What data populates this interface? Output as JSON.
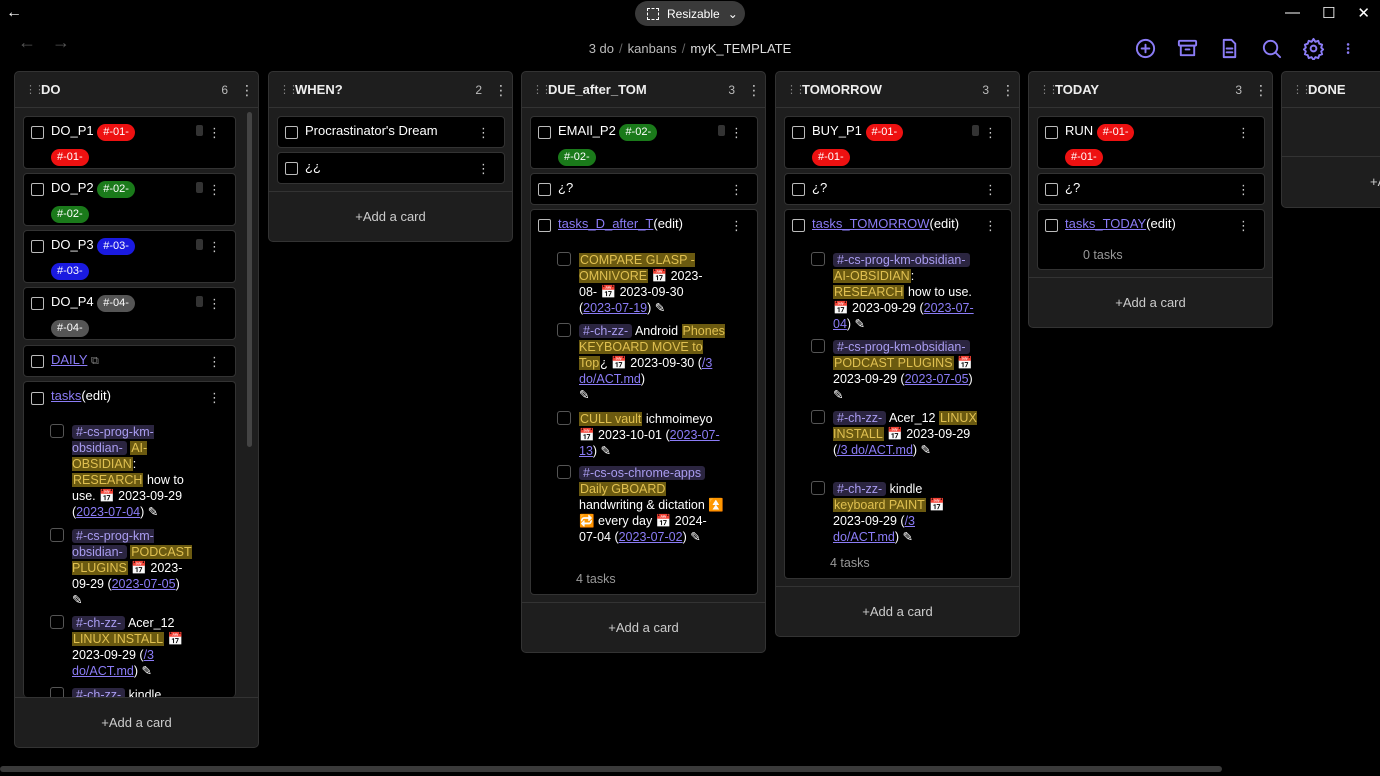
{
  "window": {
    "resize_label": "Resizable",
    "back": "←",
    "minimize": "—",
    "maximize": "☐",
    "close": "✕"
  },
  "nav": {
    "back": "←",
    "forward": "→"
  },
  "breadcrumb": [
    "3 do",
    "kanbans",
    "myK_TEMPLATE"
  ],
  "toolbar_icons": [
    "add-circle-icon",
    "archive-icon",
    "document-icon",
    "search-icon",
    "gear-icon",
    "more-vertical-icon"
  ],
  "add_card_label": "+Add a card",
  "lanes": {
    "do": {
      "title": "DO",
      "count": "6"
    },
    "when": {
      "title": "WHEN?",
      "count": "2"
    },
    "due": {
      "title": "DUE_after_TOM",
      "count": "3"
    },
    "tomorrow": {
      "title": "TOMORROW",
      "count": "3"
    },
    "today": {
      "title": "TODAY",
      "count": "3"
    },
    "done": {
      "title": "DONE",
      "add_partial": "+A"
    }
  },
  "cards": {
    "do_p1": "DO_P1",
    "do_p2": "DO_P2",
    "do_p3": "DO_P3",
    "do_p4": "DO_P4",
    "daily": "DAILY",
    "tasks": "tasks",
    "edit": "(edit)",
    "procrast": "Procrastinator's Dream",
    "inv": "¿¿",
    "email": "EMAIl_P2",
    "q": "¿?",
    "tasks_d": "tasks_D_after_T",
    "buy": "BUY_P1",
    "tasks_tom": "tasks_TOMORROW",
    "run": "RUN",
    "tasks_today": "tasks_TODAY",
    "zero": "0 tasks",
    "four": "4 tasks"
  },
  "tags": {
    "t1": "#-01-",
    "t2": "#-02-",
    "t3": "#-03-",
    "t4": "#-04-"
  },
  "colors": {
    "accent": "#8b7cf6",
    "red": "#ee1111",
    "green": "#1a7a1a",
    "blue": "#1a1ae0",
    "gray": "#555555"
  }
}
